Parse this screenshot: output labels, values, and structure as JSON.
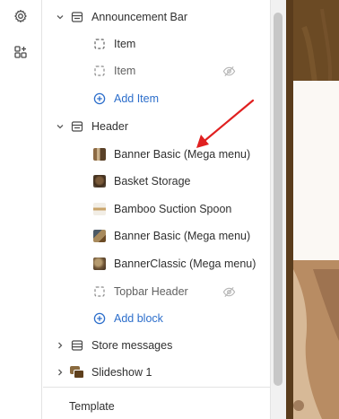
{
  "rail": {
    "settings_icon": "gear-icon",
    "apps_icon": "apps-add-icon"
  },
  "tree": {
    "announcement_bar": {
      "label": "Announcement Bar",
      "items": [
        {
          "label": "Item",
          "hidden": false
        },
        {
          "label": "Item",
          "hidden": true
        }
      ],
      "add_label": "Add Item"
    },
    "header": {
      "label": "Header",
      "blocks": [
        {
          "label": "Banner Basic (Mega menu)",
          "thumb": "banner-thumb"
        },
        {
          "label": "Basket Storage",
          "thumb": "product-thumb"
        },
        {
          "label": "Bamboo Suction Spoon",
          "thumb": "product-thumb"
        },
        {
          "label": "Banner Basic (Mega menu)",
          "thumb": "banner-thumb"
        },
        {
          "label": "BannerClassic (Mega menu)",
          "thumb": "banner-thumb"
        },
        {
          "label": "Topbar Header",
          "hidden": true
        }
      ],
      "add_label": "Add block"
    },
    "store_messages": {
      "label": "Store messages"
    },
    "slideshow": {
      "label": "Slideshow 1"
    }
  },
  "footer": {
    "template_label": "Template"
  },
  "colors": {
    "accent": "#2c6ecb",
    "annotation_arrow": "#e02020",
    "preview_bg": "#6b4a24"
  }
}
